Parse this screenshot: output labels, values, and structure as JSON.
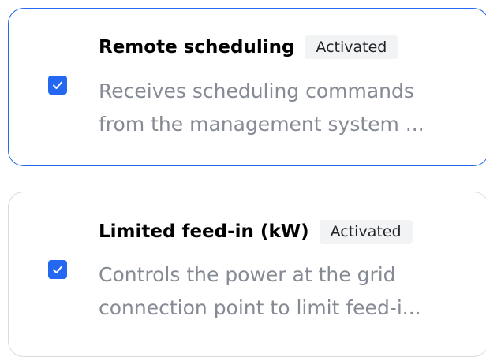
{
  "features": [
    {
      "title": "Remote scheduling",
      "status": "Activated",
      "description_line1": "Receives scheduling commands",
      "description_line2": "from the management system ...",
      "checked": true,
      "selected": true
    },
    {
      "title": "Limited feed-in (kW)",
      "status": "Activated",
      "description_line1": "Controls the power at the grid",
      "description_line2": "connection point to limit feed-i...",
      "checked": true,
      "selected": false
    }
  ],
  "colors": {
    "accent": "#2468f2",
    "border_default": "#d9dbe0",
    "badge_bg": "#f2f3f5",
    "description_text": "#858a94"
  },
  "icons": {
    "checkbox": "checkmark-icon"
  }
}
